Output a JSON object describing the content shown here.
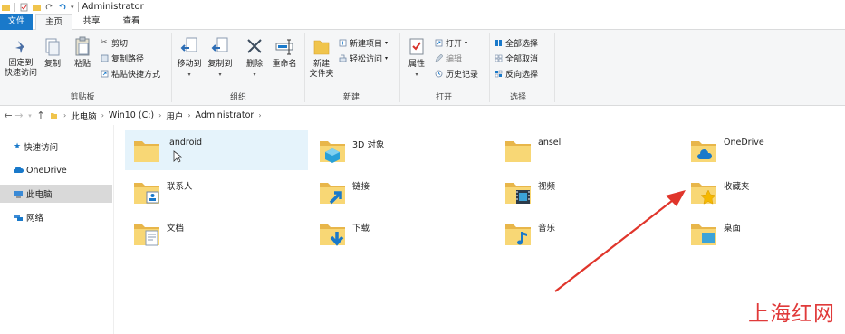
{
  "window": {
    "title": "Administrator"
  },
  "tabs": {
    "file": "文件",
    "home": "主页",
    "share": "共享",
    "view": "查看"
  },
  "ribbon": {
    "clipboard": {
      "label": "剪贴板",
      "pin": "固定到\n快速访问",
      "pin_l1": "固定到",
      "pin_l2": "快速访问",
      "copy": "复制",
      "paste": "粘贴",
      "cut": "剪切",
      "copy_path": "复制路径",
      "paste_shortcut": "粘贴快捷方式"
    },
    "organize": {
      "label": "组织",
      "move_to": "移动到",
      "copy_to": "复制到",
      "delete": "删除",
      "rename": "重命名"
    },
    "new": {
      "label": "新建",
      "new_folder_l1": "新建",
      "new_folder_l2": "文件夹",
      "new_item": "新建项目",
      "easy_access": "轻松访问"
    },
    "open": {
      "label": "打开",
      "properties": "属性",
      "open": "打开",
      "edit": "编辑",
      "history": "历史记录"
    },
    "select": {
      "label": "选择",
      "select_all": "全部选择",
      "select_none": "全部取消",
      "invert": "反向选择"
    }
  },
  "breadcrumb": [
    "此电脑",
    "Win10 (C:)",
    "用户",
    "Administrator"
  ],
  "nav": {
    "quick_access": "快速访问",
    "onedrive": "OneDrive",
    "this_pc": "此电脑",
    "network": "网络"
  },
  "items": [
    {
      "name": ".android",
      "icon": "folder-icon"
    },
    {
      "name": "3D 对象",
      "icon": "3d-objects-folder-icon"
    },
    {
      "name": "ansel",
      "icon": "folder-icon"
    },
    {
      "name": "OneDrive",
      "icon": "onedrive-folder-icon"
    },
    {
      "name": "联系人",
      "icon": "contacts-folder-icon"
    },
    {
      "name": "链接",
      "icon": "links-folder-icon"
    },
    {
      "name": "视频",
      "icon": "videos-folder-icon"
    },
    {
      "name": "收藏夹",
      "icon": "favorites-folder-icon"
    },
    {
      "name": "文档",
      "icon": "documents-folder-icon"
    },
    {
      "name": "下载",
      "icon": "downloads-folder-icon"
    },
    {
      "name": "音乐",
      "icon": "music-folder-icon"
    },
    {
      "name": "桌面",
      "icon": "desktop-folder-icon"
    }
  ],
  "colors": {
    "accent": "#1979ca",
    "folder": "#f8d775",
    "folder_dark": "#e8b64a",
    "hover": "#e5f3fb",
    "annotation_arrow": "#e0352b"
  },
  "watermark": "上海红网"
}
